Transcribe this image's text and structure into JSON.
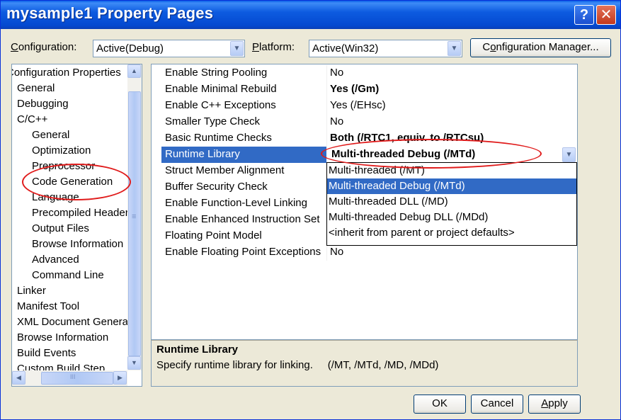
{
  "window": {
    "title": "mysample1 Property Pages",
    "help_label": "?",
    "close_label": "✕"
  },
  "toolbar": {
    "configuration_label_u": "C",
    "configuration_label_rest": "onfiguration:",
    "configuration_value": "Active(Debug)",
    "platform_label_u": "P",
    "platform_label_rest": "latform:",
    "platform_value": "Active(Win32)",
    "config_manager_pre": "C",
    "config_manager_u": "o",
    "config_manager_rest": "nfiguration Manager..."
  },
  "tree": {
    "items": [
      {
        "label": "Configuration Properties"
      },
      {
        "label": "General"
      },
      {
        "label": "Debugging"
      },
      {
        "label": "C/C++"
      },
      {
        "label": "General"
      },
      {
        "label": "Optimization"
      },
      {
        "label": "Preprocessor"
      },
      {
        "label": "Code Generation"
      },
      {
        "label": "Language"
      },
      {
        "label": "Precompiled Headers"
      },
      {
        "label": "Output Files"
      },
      {
        "label": "Browse Information"
      },
      {
        "label": "Advanced"
      },
      {
        "label": "Command Line"
      },
      {
        "label": "Linker"
      },
      {
        "label": "Manifest Tool"
      },
      {
        "label": "XML Document Generator"
      },
      {
        "label": "Browse Information"
      },
      {
        "label": "Build Events"
      },
      {
        "label": "Custom Build Step"
      }
    ],
    "hscroll_grip": "III",
    "vscroll_grip": "≡"
  },
  "properties": [
    {
      "name": "Enable String Pooling",
      "value": "No"
    },
    {
      "name": "Enable Minimal Rebuild",
      "value": "Yes (/Gm)"
    },
    {
      "name": "Enable C++ Exceptions",
      "value": "Yes (/EHsc)"
    },
    {
      "name": "Smaller Type Check",
      "value": "No"
    },
    {
      "name": "Basic Runtime Checks",
      "value": "Both (/RTC1, equiv. to /RTCsu)"
    },
    {
      "name": "Runtime Library",
      "value": "Multi-threaded Debug (/MTd)"
    },
    {
      "name": "Struct Member Alignment",
      "value": ""
    },
    {
      "name": "Buffer Security Check",
      "value": ""
    },
    {
      "name": "Enable Function-Level Linking",
      "value": ""
    },
    {
      "name": "Enable Enhanced Instruction Set",
      "value": ""
    },
    {
      "name": "Floating Point Model",
      "value": ""
    },
    {
      "name": "Enable Floating Point Exceptions",
      "value": "No"
    }
  ],
  "runtime_dropdown": {
    "options": [
      "Multi-threaded (/MT)",
      "Multi-threaded Debug (/MTd)",
      "Multi-threaded DLL (/MD)",
      "Multi-threaded Debug DLL (/MDd)",
      "<inherit from parent or project defaults>"
    ],
    "selected": "Multi-threaded Debug (/MTd)"
  },
  "description": {
    "title": "Runtime Library",
    "text": "Specify runtime library for linking.     (/MT, /MTd, /MD, /MDd)"
  },
  "buttons": {
    "ok": "OK",
    "cancel": "Cancel",
    "apply_u": "A",
    "apply_rest": "pply"
  },
  "colors": {
    "selection": "#316ac5",
    "annotation": "#e01b1b",
    "titlebar": "#0449d0"
  }
}
